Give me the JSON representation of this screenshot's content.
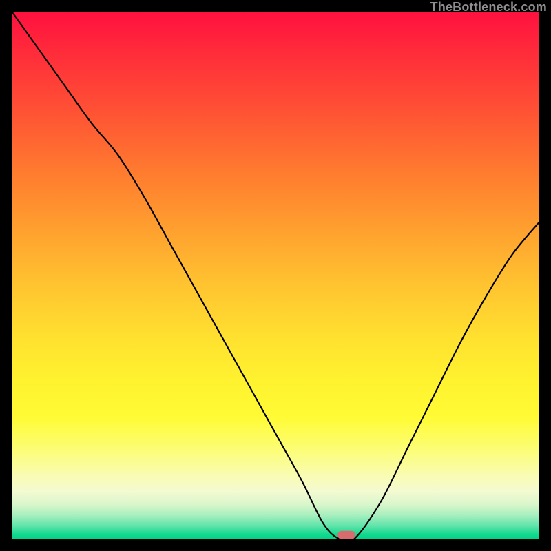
{
  "watermark": "TheBottleneck.com",
  "chart_data": {
    "type": "line",
    "title": "",
    "xlabel": "",
    "ylabel": "",
    "xlim": [
      0,
      100
    ],
    "ylim": [
      0,
      100
    ],
    "x": [
      0,
      5,
      10,
      15,
      20,
      25,
      30,
      35,
      40,
      45,
      50,
      55,
      59,
      62,
      65,
      70,
      75,
      80,
      85,
      90,
      95,
      100
    ],
    "values": [
      100,
      93,
      86,
      79,
      73,
      65,
      56,
      47,
      38,
      29,
      20,
      11,
      3,
      0,
      0,
      7,
      17,
      27,
      37,
      46,
      54,
      60
    ],
    "marker": {
      "x": 63.5,
      "y": 0.7,
      "color": "#d86b6d"
    },
    "background_gradient": {
      "top": "#ff113f",
      "mid": "#ffe12f",
      "bottom": "#00d488"
    }
  }
}
